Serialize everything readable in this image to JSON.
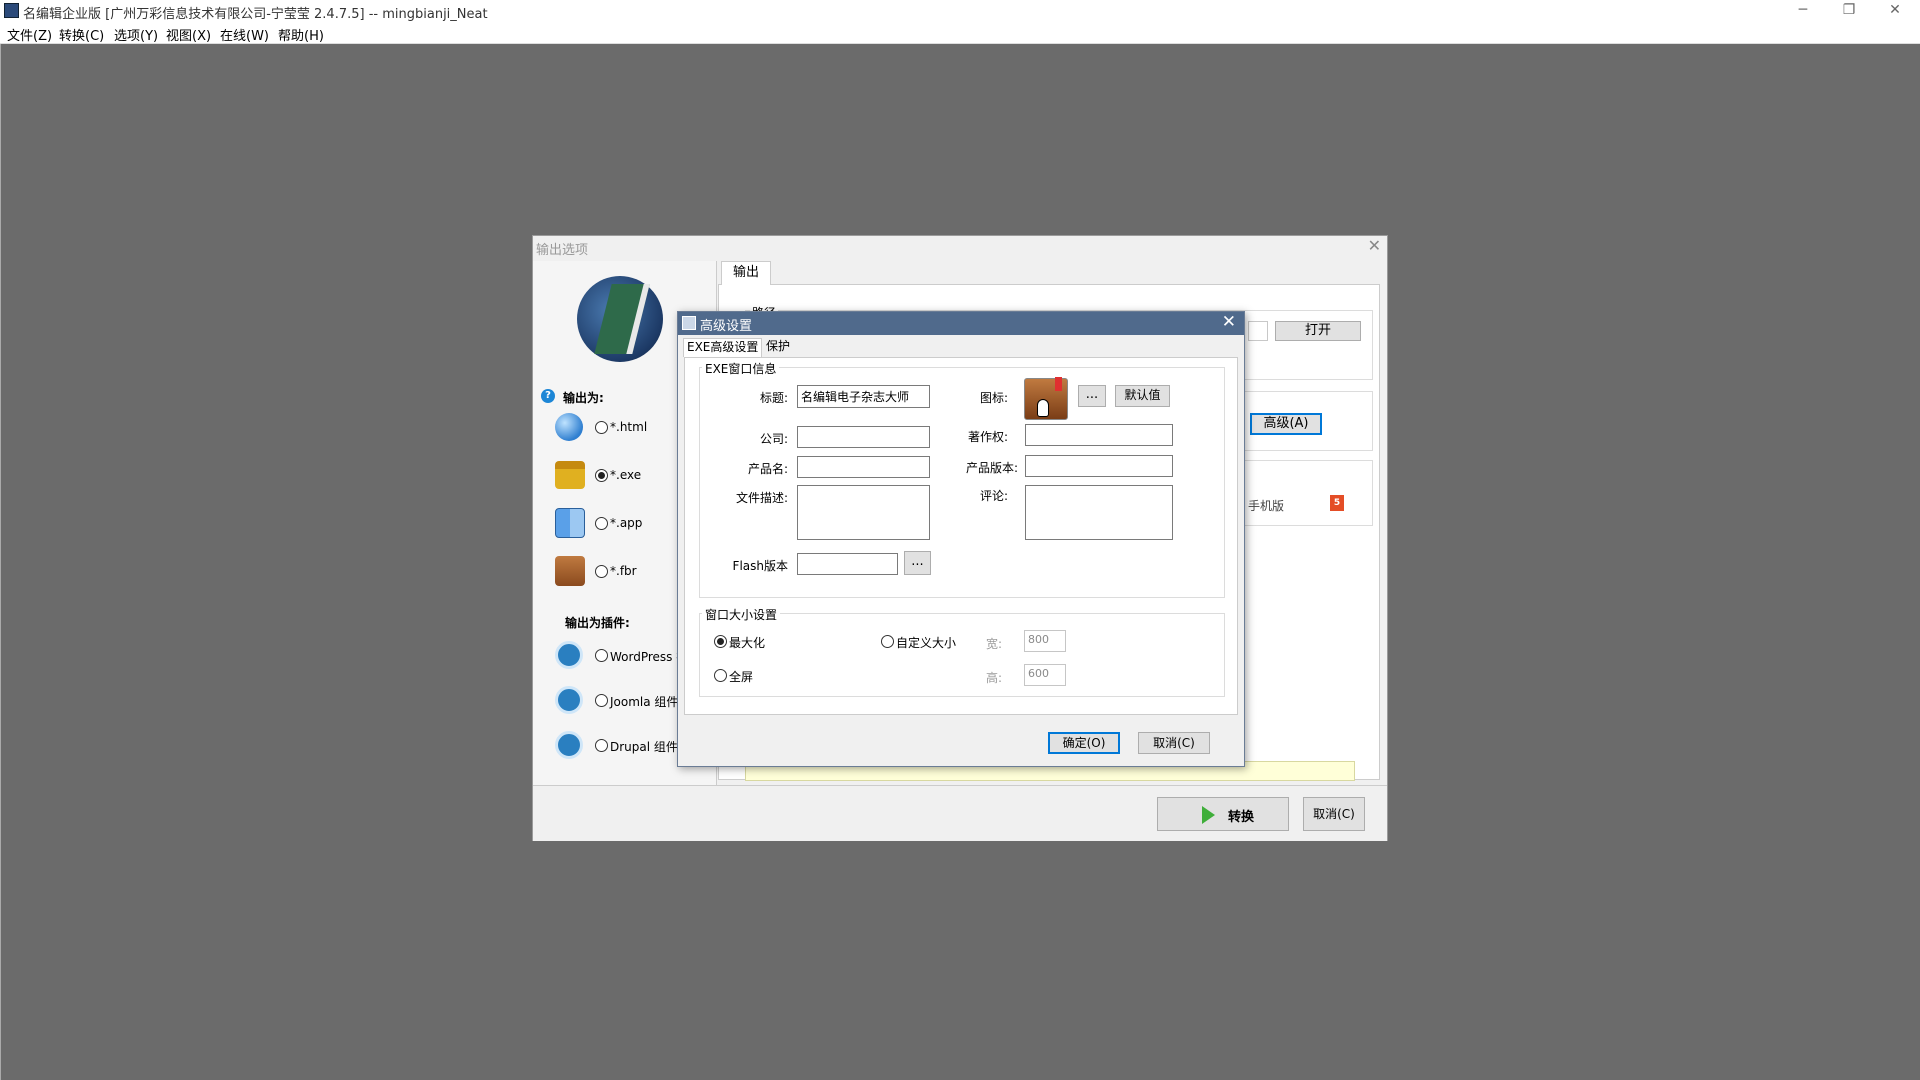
{
  "window": {
    "title": "名编辑企业版 [广州万彩信息技术有限公司-宁莹莹 2.4.7.5] -- mingbianji_Neat",
    "minimize_icon": "minimize-icon",
    "restore_icon": "restore-icon",
    "close_icon": "close-icon"
  },
  "menu": [
    "文件(Z)",
    "转换(C)",
    "选项(Y)",
    "视图(X)",
    "在线(W)",
    "帮助(H)"
  ],
  "output_dialog": {
    "title": "输出选项",
    "output_as_label": "输出为:",
    "formats": [
      {
        "label": "*.html",
        "icon": "globe-icon",
        "checked": false
      },
      {
        "label": "*.exe",
        "icon": "exe-package-icon",
        "checked": true
      },
      {
        "label": "*.app",
        "icon": "mac-finder-icon",
        "checked": false
      },
      {
        "label": "*.fbr",
        "icon": "book-icon",
        "checked": false
      }
    ],
    "plugins_label": "输出为插件:",
    "plugins": [
      {
        "label": "WordPress 插",
        "icon": "wordpress-icon",
        "checked": false
      },
      {
        "label": "Joomla 组件",
        "icon": "joomla-icon",
        "checked": false
      },
      {
        "label": "Drupal 组件",
        "icon": "drupal-icon",
        "checked": false
      }
    ],
    "tab_output": "输出",
    "path_label": "路径",
    "open_button": "打开",
    "advanced_button": "高级(A)",
    "mobile_label": "手机版",
    "convert_button": "转换",
    "cancel_button": "取消(C)"
  },
  "advanced_dialog": {
    "title": "高级设置",
    "tabs": [
      "EXE高级设置",
      "保护"
    ],
    "window_info_legend": "EXE窗口信息",
    "title_label": "标题:",
    "title_value": "名编辑电子杂志大师",
    "icon_label": "图标:",
    "browse_button": "...",
    "default_button": "默认值",
    "company_label": "公司:",
    "company_value": "",
    "copyright_label": "著作权:",
    "copyright_value": "",
    "product_name_label": "产品名:",
    "product_name_value": "",
    "product_version_label": "产品版本:",
    "product_version_value": "",
    "file_desc_label": "文件描述:",
    "file_desc_value": "",
    "comment_label": "评论:",
    "comment_value": "",
    "flash_version_label": "Flash版本",
    "flash_version_value": "",
    "flash_browse_button": "...",
    "window_size_legend": "窗口大小设置",
    "maximize_label": "最大化",
    "maximize_checked": true,
    "fullscreen_label": "全屏",
    "fullscreen_checked": false,
    "custom_size_label": "自定义大小",
    "custom_size_checked": false,
    "width_label": "宽:",
    "width_value": "800",
    "height_label": "高:",
    "height_value": "600",
    "ok_button": "确定(O)",
    "cancel_button": "取消(C)"
  }
}
